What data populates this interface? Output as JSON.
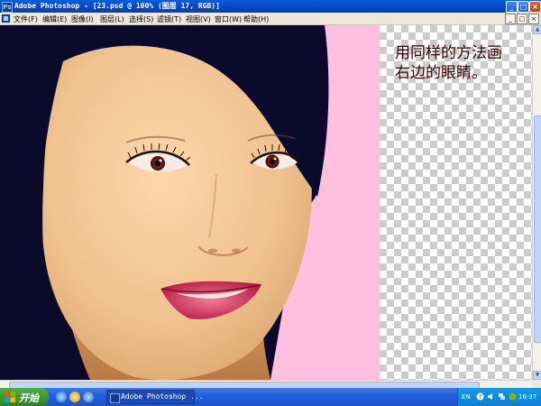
{
  "window": {
    "title": "Adobe Photoshop - [23.psd @ 100% (图层 17, RGB)]",
    "app_icon_text": "Ps",
    "controls": [
      "_",
      "□",
      "×"
    ]
  },
  "menu": {
    "items": [
      "文件(F)",
      "编辑(E)",
      "图像(I)",
      "图层(L)",
      "选择(S)",
      "滤镜(T)",
      "视图(V)",
      "窗口(W)",
      "帮助(H)"
    ],
    "mdi_controls": [
      "_",
      "□",
      "×"
    ]
  },
  "canvas": {
    "instruction_lines": [
      "用同样的方法画",
      "右边的眼睛。"
    ],
    "background_color": "#ffc0e0",
    "hair_color": "#0c0a2a",
    "skin_color": "#f3c998"
  },
  "scrollbar": {
    "up": "▲",
    "down": "▼"
  },
  "taskbar": {
    "start_label": "开始",
    "task_button_label": "Adobe Photoshop ...",
    "tray_lang": "EN",
    "clock": "16:37",
    "colors": {
      "taskbar": "#245edb",
      "start": "#3a962f",
      "tray": "#0f7fd8"
    }
  }
}
